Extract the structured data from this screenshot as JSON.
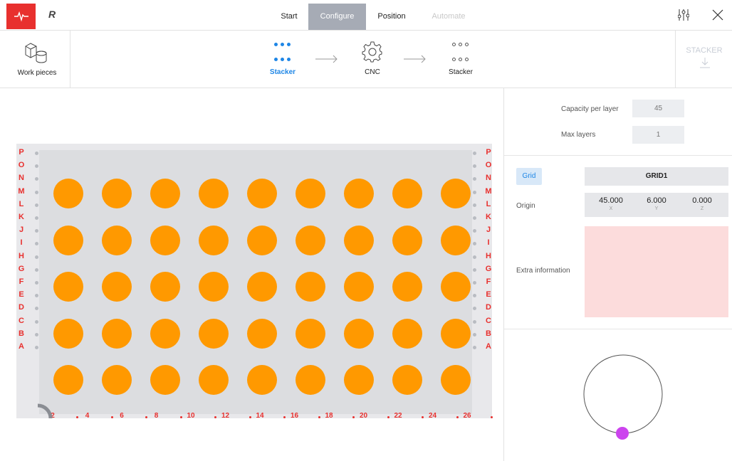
{
  "topbar": {
    "logo_text": "R",
    "tabs": [
      {
        "label": "Start",
        "state": "normal"
      },
      {
        "label": "Configure",
        "state": "active"
      },
      {
        "label": "Position",
        "state": "normal"
      },
      {
        "label": "Automate",
        "state": "disabled"
      }
    ],
    "icons": [
      "pulse-icon",
      "sliders-icon",
      "close-icon"
    ]
  },
  "toolbar": {
    "workpieces_label": "Work pieces",
    "flow": [
      {
        "label": "Stacker",
        "state": "active",
        "icon": "dots-filled-icon"
      },
      {
        "label": "CNC",
        "state": "normal",
        "icon": "gear-icon"
      },
      {
        "label": "Stacker",
        "state": "normal",
        "icon": "dots-hollow-icon"
      }
    ],
    "stacker_button_label": "STACKER"
  },
  "board": {
    "row_labels": [
      "P",
      "O",
      "N",
      "M",
      "L",
      "K",
      "J",
      "I",
      "H",
      "G",
      "F",
      "E",
      "D",
      "C",
      "B",
      "A"
    ],
    "column_labels": [
      "2",
      "4",
      "6",
      "8",
      "10",
      "12",
      "14",
      "16",
      "18",
      "20",
      "22",
      "24",
      "26"
    ],
    "piece_rows": 5,
    "piece_columns": 9,
    "piece_color": "#ff9900",
    "label_color": "#e8302e"
  },
  "settings": {
    "capacity_label": "Capacity per layer",
    "capacity_value": "45",
    "max_layers_label": "Max layers",
    "max_layers_value": "1",
    "grid_button_label": "Grid",
    "grid_name": "GRID1",
    "origin_label": "Origin",
    "origin": {
      "x": "45.000",
      "y": "6.000",
      "z": "0.000",
      "x_axis": "X",
      "y_axis": "Y",
      "z_axis": "Z"
    },
    "extra_label": "Extra information",
    "extra_value": ""
  },
  "colors": {
    "accent": "#1e86e6",
    "brand_red": "#e8302e",
    "orientation_marker": "#cc44ee"
  }
}
